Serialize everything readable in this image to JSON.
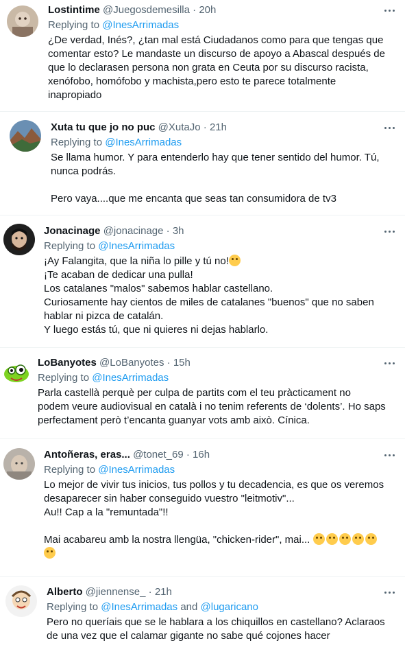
{
  "tweets": [
    {
      "name": "Lostintime",
      "handle": "@Juegosdemesilla",
      "time": "20h",
      "replying_prefix": "Replying to ",
      "replying_to": "@InesArrimadas",
      "text": "¿De verdad, Inés?, ¿tan mal está Ciudadanos como para que tengas que\ncomentar esto? Le mandaste un discurso de apoyo a Abascal después de\nque lo declarasen persona non grata en Ceuta por su discurso racista,\nxenófobo, homófobo y machista,pero esto te parece totalmente\ninapropiado"
    },
    {
      "name": "Xuta tu que jo no puc",
      "handle": "@XutaJo",
      "time": "21h",
      "replying_prefix": "Replying to ",
      "replying_to": "@InesArrimadas",
      "text": "Se llama humor. Y para entenderlo hay que tener sentido del humor. Tú,\nnunca podrás.\n\nPero vaya....que me encanta que seas tan consumidora de tv3"
    },
    {
      "name": "Jonacinage",
      "handle": "@jonacinage",
      "time": "3h",
      "replying_prefix": "Replying to ",
      "replying_to": "@InesArrimadas",
      "text": "¡Ay Falangita, que la niña lo pille y tú no!",
      "text_rest": "\n¡Te acaban de dedicar una pulla!\nLos catalanes \"malos\" sabemos hablar castellano.\nCuriosamente hay cientos de miles de catalanes \"buenos\" que no saben\nhablar ni pizca de catalán.\nY luego estás tú, que ni quieres ni dejas hablarlo."
    },
    {
      "name": "LoBanyotes",
      "handle": "@LoBanyotes",
      "time": "15h",
      "replying_prefix": "Replying to ",
      "replying_to": "@InesArrimadas",
      "text": "Parla castellà perquè per culpa de partits com el teu pràcticament no\npodem veure audiovisual en català i no tenim referents de ‘dolents’. Ho saps\nperfectament però t’encanta guanyar vots amb això. Cínica."
    },
    {
      "name": "Antoñeras, eras...",
      "handle": "@tonet_69",
      "time": "16h",
      "replying_prefix": "Replying to ",
      "replying_to": "@InesArrimadas",
      "text": "Lo mejor de vivir tus inicios, tus pollos y tu decadencia, es que os veremos\ndesaparecer sin haber conseguido vuestro \"leitmotiv\"...\nAu!! Cap a la \"remuntada\"!!\n\nMai acabareu amb la nostra llengüa, \"chicken-rider\", mai..."
    },
    {
      "name": "Alberto",
      "handle": "@jiennense_",
      "time": "21h",
      "replying_prefix": "Replying to ",
      "replying_to": "@InesArrimadas",
      "replying_and": " and ",
      "replying_to_2": "@lugaricano",
      "text": "Pero no queríais que se le hablara a los chiquillos en castellano? Aclaraos\nde una vez que el calamar gigante no sabe qué cojones hacer"
    }
  ],
  "separator": " · ",
  "icons": {
    "more": "more-options-icon",
    "emoji": "emoji-icon"
  }
}
